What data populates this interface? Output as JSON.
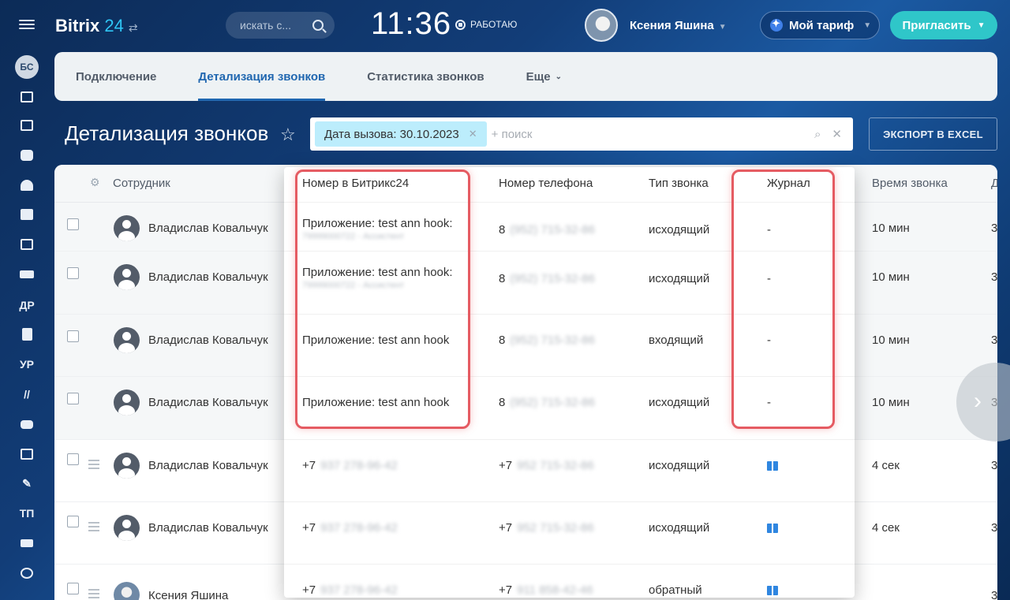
{
  "header": {
    "logo_brand": "Bitrix",
    "logo_num": "24",
    "search_placeholder": "искать с...",
    "clock": "11:36",
    "status": "РАБОТАЮ",
    "user_name": "Ксения Яшина",
    "tariff_label": "Мой тариф",
    "invite_label": "Пригласить"
  },
  "rail": {
    "avatar_initials": "БС",
    "items": [
      "ДР",
      "УР",
      "ТП"
    ]
  },
  "tabs": [
    {
      "label": "Подключение",
      "active": false
    },
    {
      "label": "Детализация звонков",
      "active": true
    },
    {
      "label": "Статистика звонков",
      "active": false
    },
    {
      "label": "Еще",
      "active": false
    }
  ],
  "page": {
    "title": "Детализация звонков",
    "filter_chip": "Дата вызова: 30.10.2023",
    "filter_placeholder": "+ поиск",
    "export_label": "ЭКСПОРТ В EXCEL"
  },
  "grid": {
    "col_employee": "Сотрудник",
    "col_time": "Время звонка",
    "col_more": "Д",
    "rows": [
      {
        "name": "Владислав Ковальчук",
        "time": "10 мин",
        "edge": "3"
      },
      {
        "name": "Владислав Ковальчук",
        "time": "10 мин",
        "edge": "3"
      },
      {
        "name": "Владислав Ковальчук",
        "time": "10 мин",
        "edge": "3"
      },
      {
        "name": "Владислав Ковальчук",
        "time": "10 мин",
        "edge": "3"
      },
      {
        "name": "Владислав Ковальчук",
        "time": "4 сек",
        "edge": "3"
      },
      {
        "name": "Владислав Ковальчук",
        "time": "4 сек",
        "edge": "3"
      },
      {
        "name": "Ксения Яшина",
        "time": "",
        "edge": "3"
      }
    ]
  },
  "panel": {
    "headers": {
      "bitrix_number": "Номер в Битрикс24",
      "phone": "Номер телефона",
      "type": "Тип звонка",
      "journal": "Журнал"
    },
    "rows": [
      {
        "bitrix": "Приложение: test ann hook:",
        "bitrix_sub": "79999000722 - Ассистент",
        "phone_prefix": "8",
        "phone_blur": "(952) 715-32-86",
        "type": "исходящий",
        "journal": "-"
      },
      {
        "bitrix": "Приложение: test ann hook:",
        "bitrix_sub": "79999000722 - Ассистент",
        "phone_prefix": "8",
        "phone_blur": "(952) 715-32-86",
        "type": "исходящий",
        "journal": "-"
      },
      {
        "bitrix": "Приложение: test ann hook",
        "bitrix_sub": "",
        "phone_prefix": "8",
        "phone_blur": "(952) 715-32-86",
        "type": "входящий",
        "journal": "-"
      },
      {
        "bitrix": "Приложение: test ann hook",
        "bitrix_sub": "",
        "phone_prefix": "8",
        "phone_blur": "(952) 715-32-86",
        "type": "исходящий",
        "journal": "-"
      },
      {
        "bitrix": "+7",
        "bitrix_blur": "937 278-96-42",
        "phone_prefix": "+7",
        "phone_blur": "952 715-32-86",
        "type": "исходящий",
        "journal": "book"
      },
      {
        "bitrix": "+7",
        "bitrix_blur": "937 278-96-42",
        "phone_prefix": "+7",
        "phone_blur": "952 715-32-86",
        "type": "исходящий",
        "journal": "book"
      },
      {
        "bitrix": "+7",
        "bitrix_blur": "937 278-96-42",
        "phone_prefix": "+7",
        "phone_blur": "911 858-42-46",
        "type": "обратный",
        "journal": "book"
      }
    ]
  },
  "colors": {
    "accent": "#2067b0",
    "invite": "#2fc6c9",
    "highlight": "#e55b62",
    "chip": "#bcedfc"
  }
}
